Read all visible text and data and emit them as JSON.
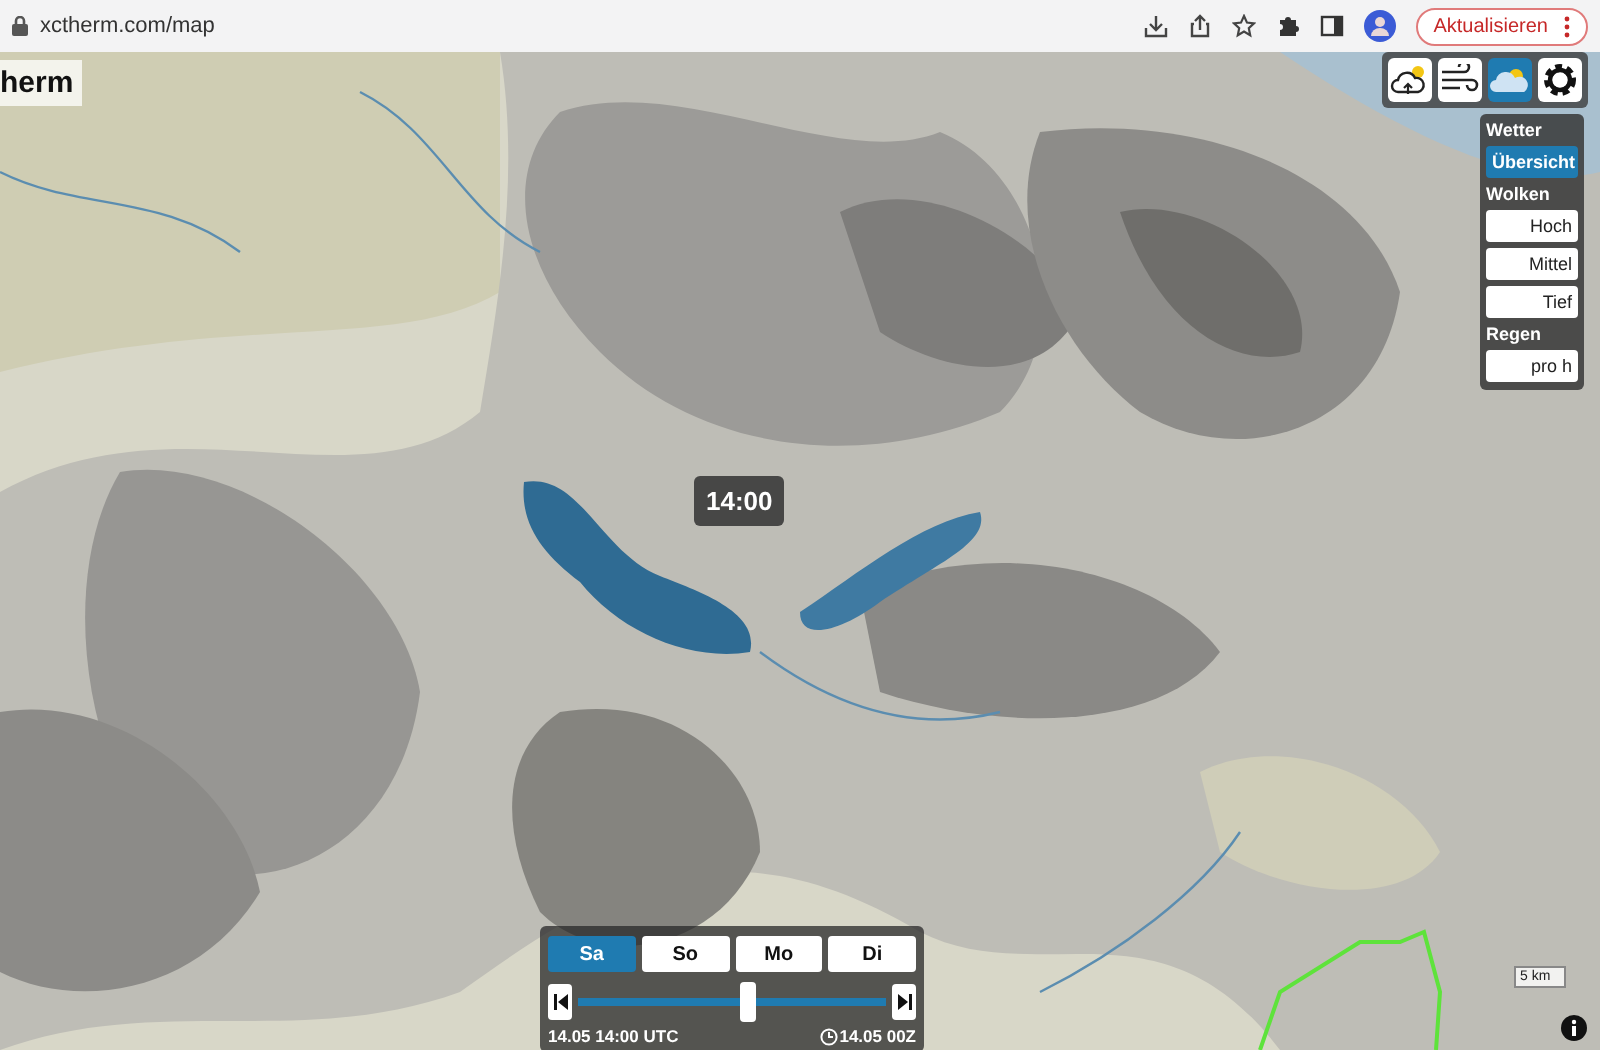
{
  "browser": {
    "url": "xctherm.com/map",
    "update_button": "Aktualisieren"
  },
  "logo": "herm",
  "layer_buttons": [
    {
      "kind": "cloud-sun",
      "selected": false
    },
    {
      "kind": "wind",
      "selected": false
    },
    {
      "kind": "clouds",
      "selected": true
    },
    {
      "kind": "settings",
      "selected": false
    }
  ],
  "panel": [
    {
      "heading": "Wetter",
      "items": [
        {
          "label": "Übersicht",
          "selected": true
        }
      ]
    },
    {
      "heading": "Wolken",
      "items": [
        {
          "label": "Hoch",
          "selected": false
        },
        {
          "label": "Mittel",
          "selected": false
        },
        {
          "label": "Tief",
          "selected": false
        }
      ]
    },
    {
      "heading": "Regen",
      "items": [
        {
          "label": "pro h",
          "selected": false
        }
      ]
    }
  ],
  "time_label": "14:00",
  "timeline": {
    "days": [
      {
        "label": "Sa",
        "selected": true
      },
      {
        "label": "So",
        "selected": false
      },
      {
        "label": "Mo",
        "selected": false
      },
      {
        "label": "Di",
        "selected": false
      }
    ],
    "level": 0.55,
    "start_label": "14.05 14:00 UTC",
    "end_label": "14.05 00Z"
  },
  "scale": "5 km"
}
